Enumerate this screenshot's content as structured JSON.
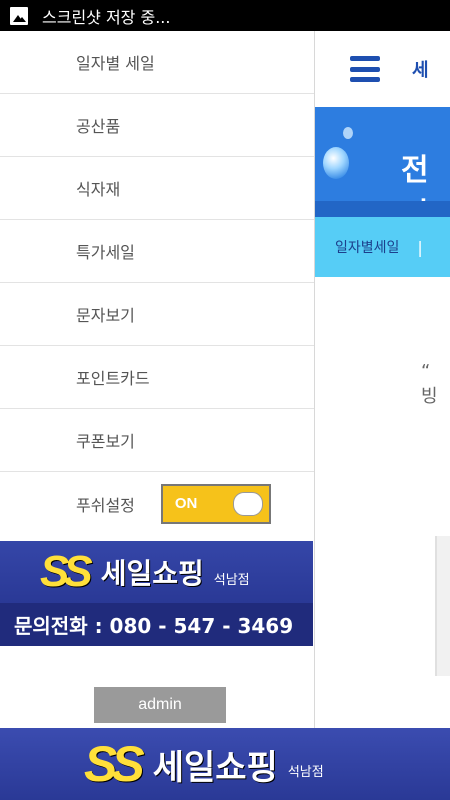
{
  "status_bar": {
    "text": "스크린샷 저장 중..."
  },
  "drawer": {
    "items": [
      {
        "label": "일자별 세일"
      },
      {
        "label": "공산품"
      },
      {
        "label": "식자재"
      },
      {
        "label": "특가세일"
      },
      {
        "label": "문자보기"
      },
      {
        "label": "포인트카드"
      },
      {
        "label": "쿠폰보기"
      },
      {
        "label": "푸쉬설정"
      }
    ],
    "push_toggle": {
      "label": "ON",
      "state": true,
      "color": "#f6c21a"
    }
  },
  "banner": {
    "logo": "SS",
    "brand": "세일쇼핑",
    "branch": "석남점",
    "phone": "문의전화 : 080 - 547 - 3469"
  },
  "admin_button": {
    "label": "admin"
  },
  "background_page": {
    "title": "세",
    "hero_text": "전디",
    "subnav": "일자별세일",
    "subnav_sep": "|",
    "quote": "“ 빙"
  },
  "bottom_banner": {
    "logo": "SS",
    "brand": "세일쇼핑",
    "branch": "석남점"
  },
  "colors": {
    "accent_blue": "#1e4fb0",
    "banner_bg": "#2a3a96",
    "logo_yellow": "#ffe03a"
  }
}
